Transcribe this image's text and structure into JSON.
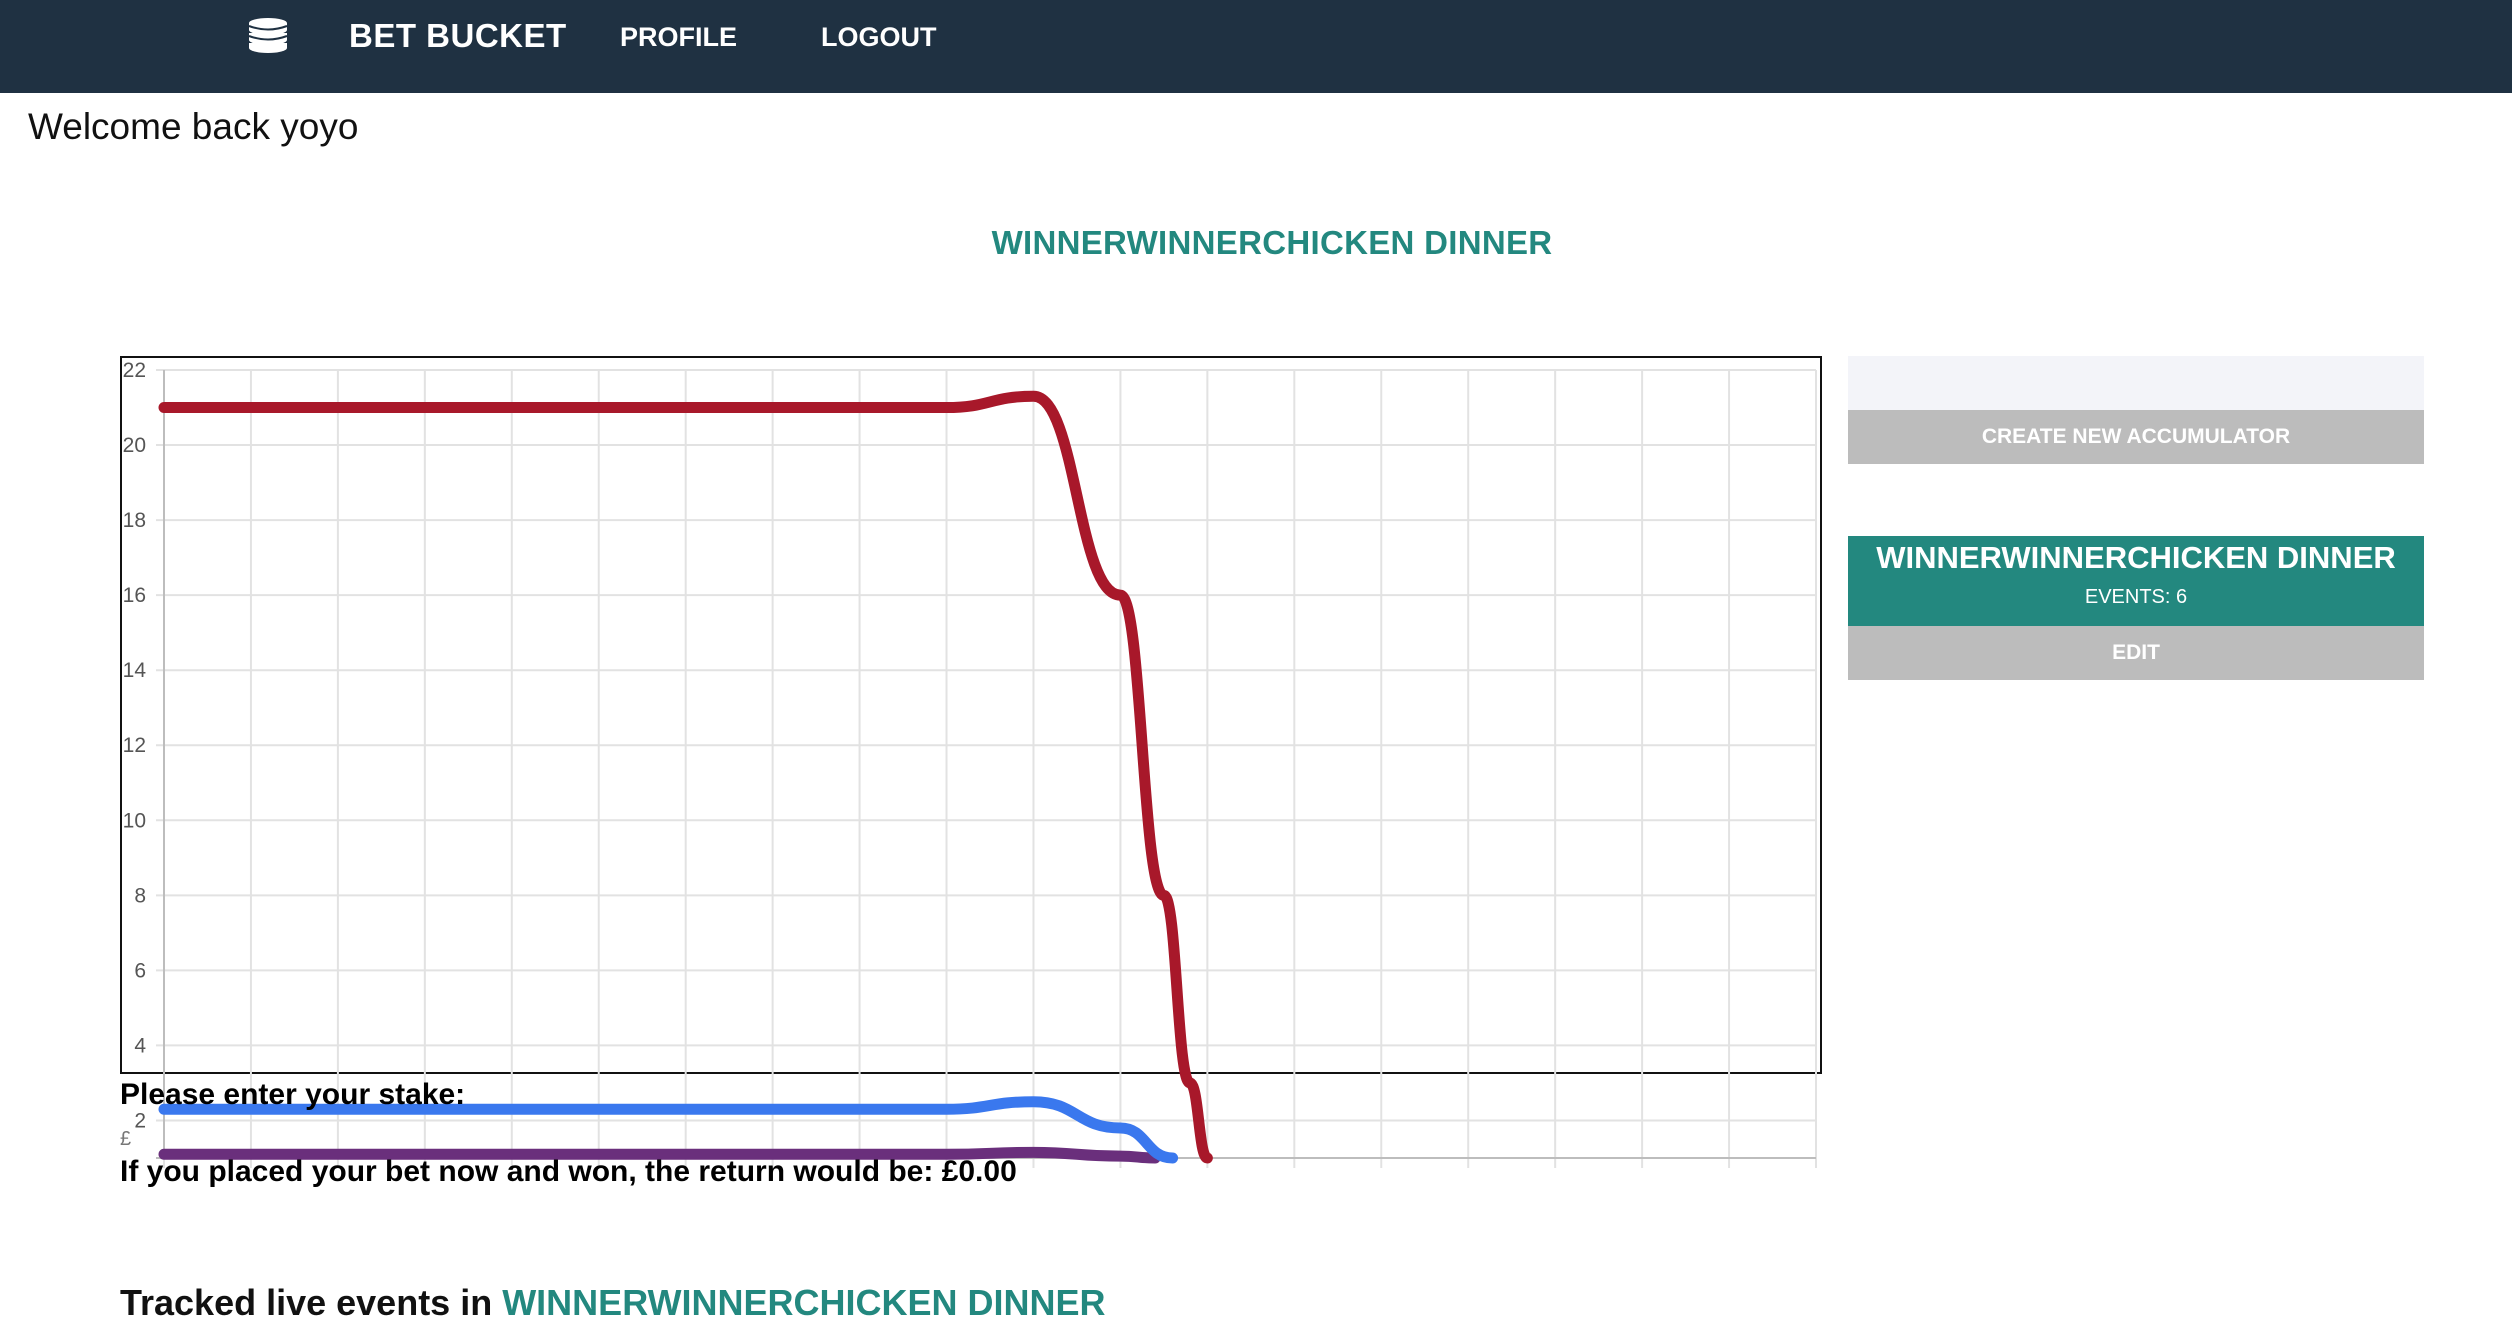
{
  "nav": {
    "brand": "BET BUCKET",
    "logo_icon": "coins-stack-icon",
    "profile_label": "PROFILE",
    "logout_label": "LOGOUT"
  },
  "welcome": "Welcome back yoyo",
  "page_title": "WINNERWINNERCHICKEN DINNER",
  "stake": {
    "label": "Please enter your stake:",
    "currency_symbol": "£",
    "return_text": "If you placed your bet now and won, the return would be: £0.00"
  },
  "tracked": {
    "prefix": "Tracked live events in ",
    "accumulator": "WINNERWINNERCHICKEN DINNER"
  },
  "sidebar": {
    "new_name_placeholder": "",
    "create_label": "CREATE NEW ACCUMULATOR",
    "accumulator": {
      "name": "WINNERWINNERCHICKEN DINNER",
      "events": "EVENTS: 6",
      "edit_label": "EDIT"
    }
  },
  "colors": {
    "navbar": "#1f3142",
    "accent": "#23887f",
    "button_gray": "#bcbcbc",
    "series_red": "#a8182a",
    "series_blue": "#3a78ee",
    "series_purple": "#6a2f7c"
  },
  "chart_data": {
    "type": "line",
    "y_ticks": [
      "2",
      "4",
      "6",
      "8",
      "10",
      "12",
      "14",
      "16",
      "18",
      "20",
      "22"
    ],
    "ylim": [
      1,
      22
    ],
    "grid": true,
    "series": [
      {
        "color": "#a8182a",
        "points": [
          [
            0,
            21
          ],
          [
            9,
            21
          ],
          [
            10,
            21.3
          ],
          [
            11,
            16
          ],
          [
            11.5,
            8
          ],
          [
            11.8,
            3
          ],
          [
            12,
            1
          ]
        ]
      },
      {
        "color": "#3a78ee",
        "points": [
          [
            0,
            2.3
          ],
          [
            9,
            2.3
          ],
          [
            10,
            2.5
          ],
          [
            11,
            1.8
          ],
          [
            11.6,
            1
          ]
        ]
      },
      {
        "color": "#6a2f7c",
        "points": [
          [
            0,
            1.1
          ],
          [
            9,
            1.1
          ],
          [
            10,
            1.15
          ],
          [
            11,
            1.05
          ],
          [
            11.4,
            1
          ]
        ]
      }
    ]
  }
}
